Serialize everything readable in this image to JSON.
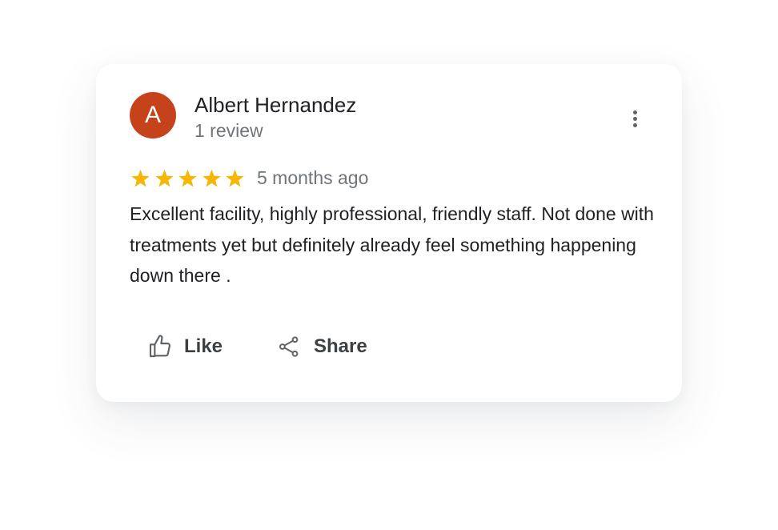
{
  "review": {
    "avatar_initial": "A",
    "avatar_color": "#c5421a",
    "reviewer_name": "Albert Hernandez",
    "review_count": "1 review",
    "rating": 5,
    "rating_max": 5,
    "star_color": "#f6b704",
    "time_ago": "5 months ago",
    "text": "Excellent facility, highly professional, friendly staff. Not done with treatments yet but definitely already feel something happening down there ."
  },
  "actions": {
    "like_label": "Like",
    "like_icon": "thumbs-up-icon",
    "share_label": "Share",
    "share_icon": "share-icon",
    "more_icon": "more-vert-icon"
  }
}
